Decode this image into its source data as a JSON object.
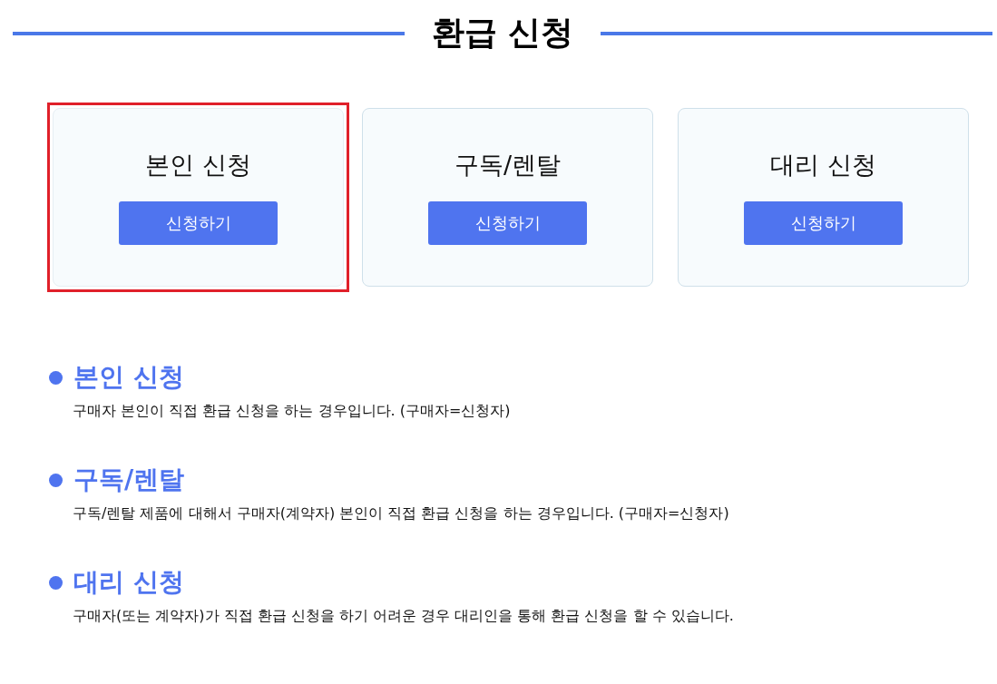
{
  "title": "환급 신청",
  "cards": [
    {
      "label": "본인 신청",
      "button": "신청하기",
      "highlighted": true
    },
    {
      "label": "구독/렌탈",
      "button": "신청하기",
      "highlighted": false
    },
    {
      "label": "대리 신청",
      "button": "신청하기",
      "highlighted": false
    }
  ],
  "sections": [
    {
      "heading": "본인 신청",
      "description": "구매자 본인이 직접 환급 신청을 하는 경우입니다. (구매자=신청자)"
    },
    {
      "heading": "구독/렌탈",
      "description": "구독/렌탈 제품에 대해서 구매자(계약자) 본인이 직접 환급 신청을 하는 경우입니다. (구매자=신청자)"
    },
    {
      "heading": "대리 신청",
      "description": "구매자(또는 계약자)가 직접 환급 신청을 하기 어려운 경우 대리인을 통해 환급 신청을 할 수 있습니다."
    }
  ]
}
